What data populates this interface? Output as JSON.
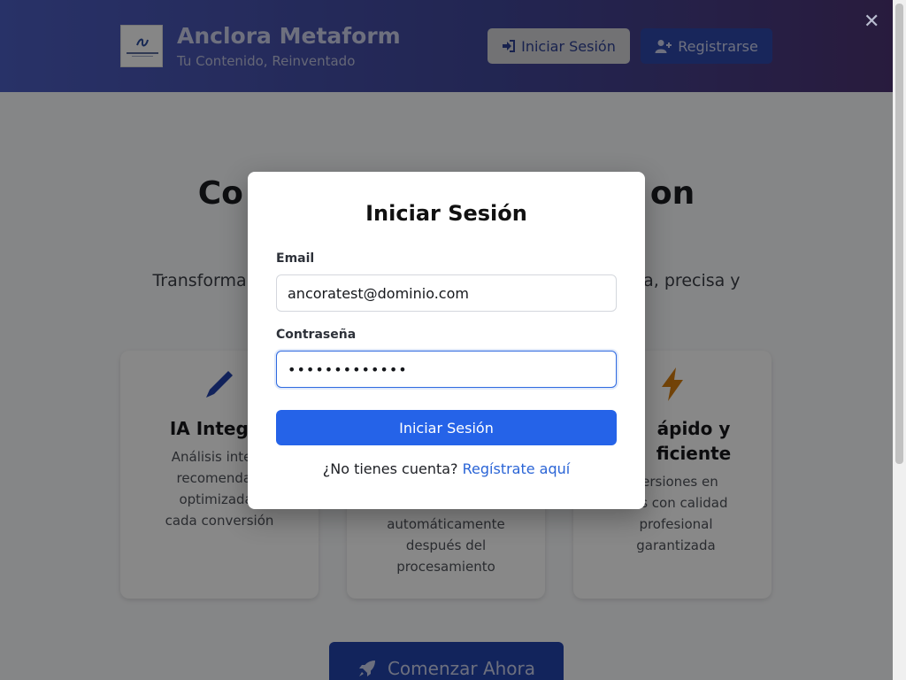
{
  "header": {
    "brand_title": "Anclora Metaform",
    "brand_subtitle": "Tu Contenido, Reinventado",
    "login_label": "Iniciar Sesión",
    "register_label": "Registrarse",
    "close_symbol": "✕"
  },
  "hero": {
    "title_left": "Co",
    "title_right": "on",
    "subtitle_left": "Transforma c",
    "subtitle_right": "da, precisa y"
  },
  "cards": [
    {
      "icon": "pen-icon",
      "title": "IA Integra",
      "desc": [
        "Análisis intelig",
        "recomendaci",
        "optimizadas",
        "cada conversión"
      ]
    },
    {
      "desc": [
        "automáticamente",
        "después del",
        "procesamiento"
      ]
    },
    {
      "icon": "bolt-icon",
      "title_lines": [
        "ápido y",
        "ficiente"
      ],
      "desc": [
        "versiones en",
        "dos con calidad",
        "profesional",
        "garantizada"
      ]
    }
  ],
  "cta_label": "Comenzar Ahora",
  "modal": {
    "title": "Iniciar Sesión",
    "email_label": "Email",
    "email_value": "ancoratest@dominio.com",
    "password_label": "Contraseña",
    "password_value": "•••••••••••••",
    "submit_label": "Iniciar Sesión",
    "signup_prompt": "¿No tienes cuenta?",
    "signup_link": "Regístrate aquí"
  },
  "colors": {
    "primary": "#2563e8",
    "header_start": "#4a5bbd",
    "header_end": "#4a3270",
    "bolt": "#d07a10"
  }
}
